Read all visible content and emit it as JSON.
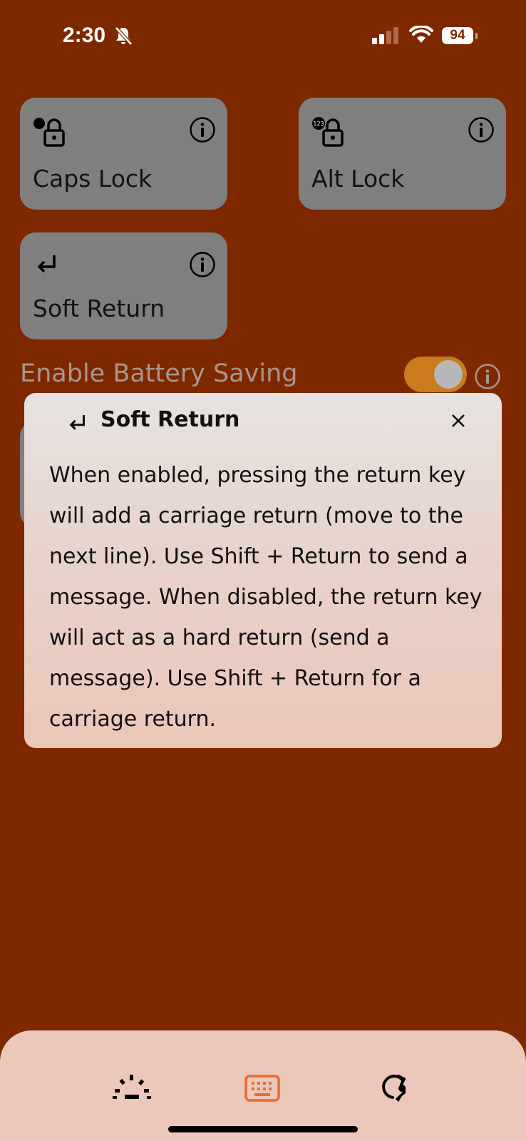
{
  "status_bar": {
    "time": "2:30",
    "battery_level": "94",
    "icons": [
      "bell-slash-icon",
      "cellular-signal-icon",
      "wifi-icon",
      "battery-icon"
    ]
  },
  "tiles": [
    {
      "label": "Caps Lock",
      "icon": "caps-lock-icon",
      "badge": ""
    },
    {
      "label": "Alt Lock",
      "icon": "alt-lock-icon",
      "badge": "123"
    },
    {
      "label": "Soft Return",
      "icon": "return-arrow-icon",
      "badge": ""
    }
  ],
  "battery_saving": {
    "label": "Enable Battery Saving",
    "enabled": true
  },
  "popover": {
    "title": "Soft Return",
    "icon": "return-arrow-icon",
    "body": "When enabled, pressing the return key will add a carriage return (move to the next line). Use Shift + Return to send a message. When disabled, the return key will act as a hard return (send a message). Use Shift + Return for a carriage return."
  },
  "bottom_nav": {
    "items": [
      "brightness-icon",
      "keyboard-icon",
      "sync-settings-icon"
    ],
    "active_index": 1
  },
  "colors": {
    "background": "#7e2800",
    "tile": "#7f7f7f",
    "accent": "#ef6a2e",
    "toggle_on": "#c97b1d",
    "bottom_bar": "#ebc8b9"
  }
}
